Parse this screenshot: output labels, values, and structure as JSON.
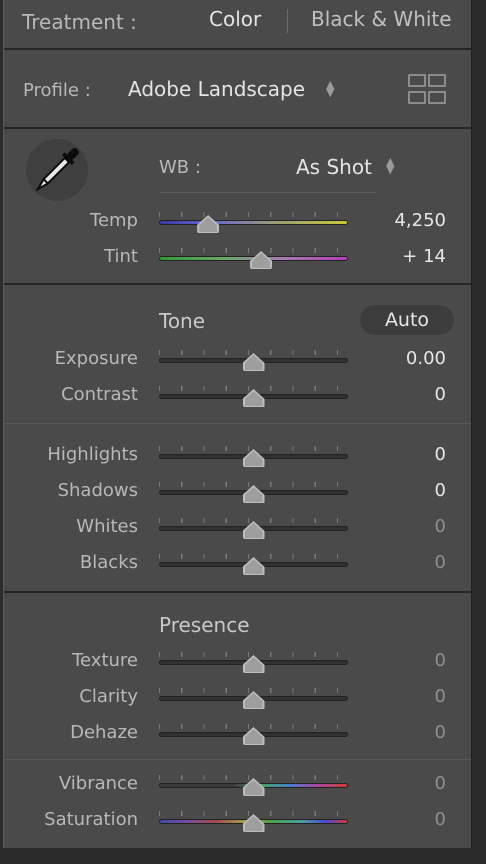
{
  "treatment": {
    "label": "Treatment :",
    "color": "Color",
    "black_white": "Black & White"
  },
  "profile": {
    "label": "Profile :",
    "value": "Adobe Landscape",
    "browser_icon": "grid-icon"
  },
  "wb": {
    "label": "WB :",
    "value": "As Shot",
    "tool_icon": "eyedropper-icon",
    "temp": {
      "label": "Temp",
      "value": "4,250",
      "position": 0.26
    },
    "tint": {
      "label": "Tint",
      "value": "+ 14",
      "position": 0.54
    }
  },
  "tone": {
    "title": "Tone",
    "auto_label": "Auto",
    "sliders": [
      {
        "label": "Exposure",
        "value": "0.00",
        "position": 0.5
      },
      {
        "label": "Contrast",
        "value": "0",
        "position": 0.5
      }
    ],
    "sliders2": [
      {
        "label": "Highlights",
        "value": "0",
        "position": 0.5
      },
      {
        "label": "Shadows",
        "value": "0",
        "position": 0.5
      },
      {
        "label": "Whites",
        "value": "0",
        "position": 0.5
      },
      {
        "label": "Blacks",
        "value": "0",
        "position": 0.5
      }
    ]
  },
  "presence": {
    "title": "Presence",
    "sliders": [
      {
        "label": "Texture",
        "value": "0",
        "position": 0.5
      },
      {
        "label": "Clarity",
        "value": "0",
        "position": 0.5
      },
      {
        "label": "Dehaze",
        "value": "0",
        "position": 0.5
      }
    ],
    "sliders2": [
      {
        "label": "Vibrance",
        "value": "0",
        "position": 0.5
      },
      {
        "label": "Saturation",
        "value": "0",
        "position": 0.5
      }
    ]
  },
  "colors": {
    "panel_bg": "#4a4a4a",
    "text_primary": "#e4e4e4",
    "text_label": "#b8b8b8"
  }
}
